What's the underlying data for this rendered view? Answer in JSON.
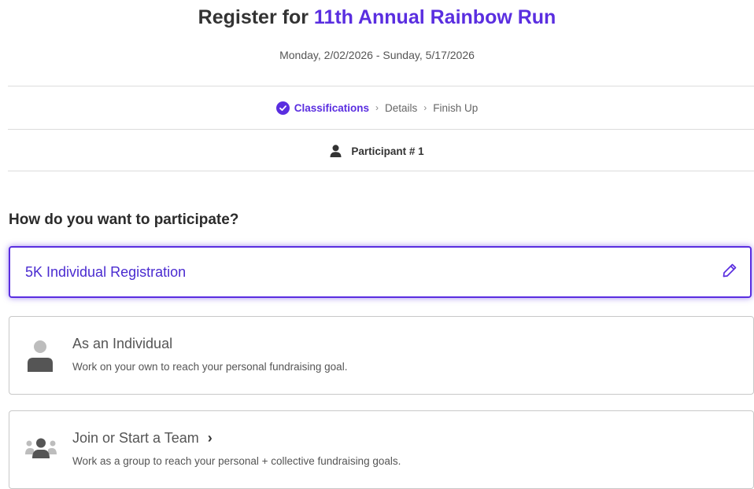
{
  "header": {
    "title_prefix": "Register for",
    "event_name": "11th Annual Rainbow Run",
    "dates": "Monday, 2/02/2026 - Sunday, 5/17/2026"
  },
  "steps": {
    "active": "Classifications",
    "items": [
      "Details",
      "Finish Up"
    ],
    "separator": "›"
  },
  "participant": {
    "label": "Participant # 1"
  },
  "question": "How do you want to participate?",
  "selected": {
    "label": "5K Individual Registration",
    "edit_icon": "pencil-icon"
  },
  "options": [
    {
      "title": "As an Individual",
      "description": "Work on your own to reach your personal fundraising goal.",
      "icon": "person-icon"
    },
    {
      "title": "Join or Start a Team",
      "chevron": "›",
      "description": "Work as a group to reach your personal + collective fundraising goals.",
      "icon": "group-icon"
    }
  ],
  "colors": {
    "accent": "#5a2ee0",
    "border": "#c8c8c8",
    "text": "#2b2b2b",
    "icon_gray": "#9e9e9e"
  }
}
